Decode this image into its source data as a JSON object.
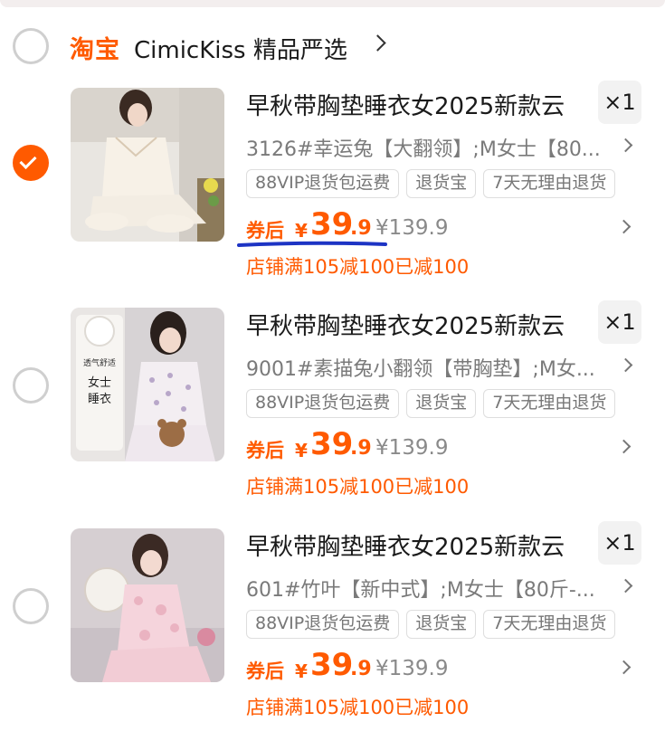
{
  "shop": {
    "platform": "淘宝",
    "name": "CimicKiss 精品严选"
  },
  "items": [
    {
      "checked": true,
      "title": "早秋带胸垫睡衣女2025新款云",
      "qty": "×1",
      "sku": "3126#幸运兔【大翻领】;M女士【80...",
      "tags": [
        "88VIP退货包运费",
        "退货宝",
        "7天无理由退货"
      ],
      "price_label": "券后",
      "currency": "¥",
      "price_int": "39",
      "price_dec": ".9",
      "original_price": "¥139.9",
      "promo": "店铺满105减100已减100",
      "thumb_box_text": []
    },
    {
      "checked": false,
      "title": "早秋带胸垫睡衣女2025新款云",
      "qty": "×1",
      "sku": "9001#素描兔小翻领【带胸垫】;M女...",
      "tags": [
        "88VIP退货包运费",
        "退货宝",
        "7天无理由退货"
      ],
      "price_label": "券后",
      "currency": "¥",
      "price_int": "39",
      "price_dec": ".9",
      "original_price": "¥139.9",
      "promo": "店铺满105减100已减100",
      "thumb_box_text": [
        "透气舒适",
        "女士",
        "睡衣"
      ]
    },
    {
      "checked": false,
      "title": "早秋带胸垫睡衣女2025新款云",
      "qty": "×1",
      "sku": "601#竹叶【新中式】;M女士【80斤-...",
      "tags": [
        "88VIP退货包运费",
        "退货宝",
        "7天无理由退货"
      ],
      "price_label": "券后",
      "currency": "¥",
      "price_int": "39",
      "price_dec": ".9",
      "original_price": "¥139.9",
      "promo": "店铺满105减100已减100",
      "thumb_box_text": []
    }
  ],
  "colors": {
    "accent": "#ff5a00",
    "annotation": "#1d34c4"
  }
}
